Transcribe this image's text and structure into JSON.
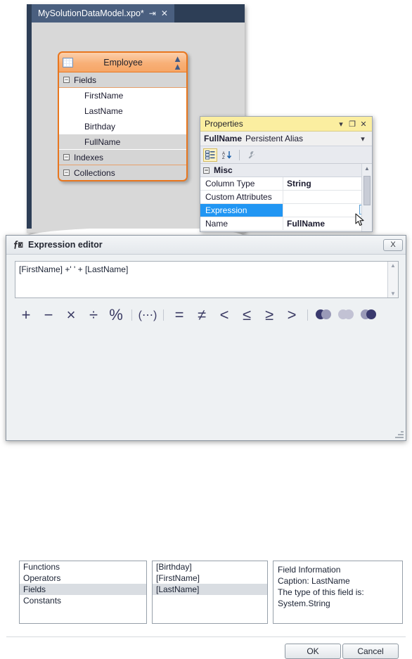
{
  "designer": {
    "tab_title": "MySolutionDataModel.xpo*",
    "pin_icon": "pin-icon",
    "close_icon": "close-icon",
    "class_card": {
      "icon": "table-grid-icon",
      "title": "Employee",
      "collapse_icon": "chevron-double-up-icon",
      "sections": [
        {
          "label": "Fields",
          "expander": "−",
          "items": [
            "FirstName",
            "LastName",
            "Birthday",
            "FullName"
          ],
          "selected_item": "FullName"
        },
        {
          "label": "Indexes",
          "expander": "−",
          "items": []
        },
        {
          "label": "Collections",
          "expander": "−",
          "items": []
        }
      ]
    }
  },
  "properties": {
    "title": "Properties",
    "titlebar_buttons": [
      "▾",
      "❐",
      "✕"
    ],
    "object_name": "FullName",
    "object_type": "Persistent Alias",
    "dropdown_icon": "chevron-down-icon",
    "toolbar": {
      "categorized_icon": "categorized-view-icon",
      "alphabetical_icon": "alphabetical-sort-icon",
      "property_pages_icon": "wrench-icon"
    },
    "category": {
      "label": "Misc",
      "expander": "−"
    },
    "rows": [
      {
        "name": "Column Type",
        "value": "String",
        "selected": false,
        "has_ellipsis": false
      },
      {
        "name": "Custom Attributes",
        "value": "",
        "selected": false,
        "has_ellipsis": false
      },
      {
        "name": "Expression",
        "value": "",
        "selected": true,
        "has_ellipsis": true,
        "ellipsis_label": "..."
      },
      {
        "name": "Name",
        "value": "FullName",
        "selected": false,
        "has_ellipsis": false
      }
    ],
    "scrollbar": {
      "up": "▲",
      "down": "▼"
    }
  },
  "expression_editor": {
    "icon": "fx-function-icon",
    "title": "Expression editor",
    "close_label": "X",
    "expression_value": "[FirstName] +' ' + [LastName]",
    "scroll_up": "▲",
    "scroll_down": "▼",
    "operators": [
      {
        "name": "plus-operator",
        "glyph": "+",
        "size": "big"
      },
      {
        "name": "minus-operator",
        "glyph": "−",
        "size": "big"
      },
      {
        "name": "multiply-operator",
        "glyph": "×",
        "size": "big"
      },
      {
        "name": "divide-operator",
        "glyph": "÷",
        "size": "big"
      },
      {
        "name": "modulo-operator",
        "glyph": "%",
        "size": "big"
      },
      {
        "name": "separator",
        "glyph": "",
        "size": "sep"
      },
      {
        "name": "parentheses-operator",
        "glyph": "(⋯)",
        "size": "small"
      },
      {
        "name": "separator",
        "glyph": "",
        "size": "sep"
      },
      {
        "name": "equal-operator",
        "glyph": "=",
        "size": "big"
      },
      {
        "name": "not-equal-operator",
        "glyph": "≠",
        "size": "big"
      },
      {
        "name": "less-than-operator",
        "glyph": "<",
        "size": "big"
      },
      {
        "name": "less-or-equal-operator",
        "glyph": "≤",
        "size": "big"
      },
      {
        "name": "greater-or-equal-operator",
        "glyph": "≥",
        "size": "big"
      },
      {
        "name": "greater-than-operator",
        "glyph": ">",
        "size": "big"
      },
      {
        "name": "separator",
        "glyph": "",
        "size": "sep"
      },
      {
        "name": "and-operator",
        "glyph": "",
        "size": "venn-and"
      },
      {
        "name": "or-operator",
        "glyph": "",
        "size": "venn-or"
      },
      {
        "name": "not-operator",
        "glyph": "",
        "size": "venn-not"
      }
    ],
    "categories": {
      "items": [
        "Functions",
        "Operators",
        "Fields",
        "Constants"
      ],
      "selected": "Fields"
    },
    "items": {
      "items": [
        "[Birthday]",
        "[FirstName]",
        "[LastName]"
      ],
      "selected": "[LastName]"
    },
    "info": {
      "lines": [
        "Field Information",
        "Caption: LastName",
        "The type of this field is:",
        "System.String"
      ]
    },
    "ok_label": "OK",
    "cancel_label": "Cancel"
  },
  "colors": {
    "vs_titlebar": "#2d3e56",
    "vs_tab": "#4a5f7f",
    "card_border": "#e8761e",
    "card_header": "#f8b077",
    "properties_titlebar": "#fbeea0",
    "selection_blue": "#2196f3",
    "operator_ink": "#3a3a63"
  }
}
